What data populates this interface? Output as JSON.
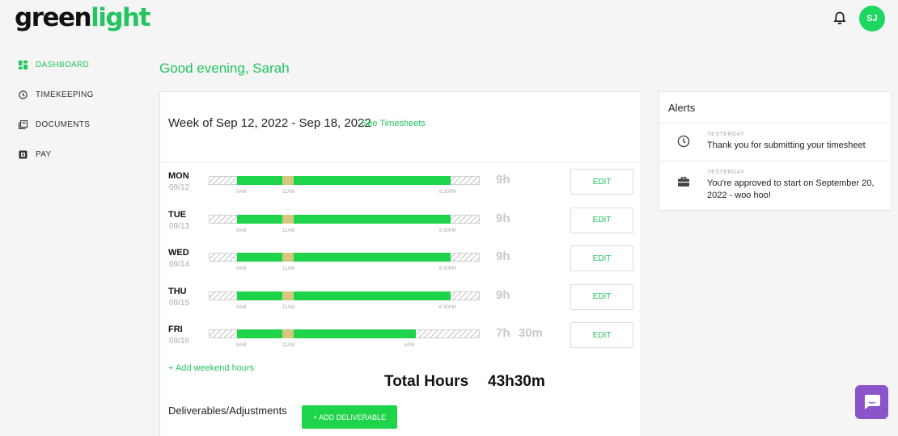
{
  "logo": {
    "part1": "green",
    "part2": "light"
  },
  "header": {
    "avatar_initials": "SJ"
  },
  "sidebar": {
    "items": [
      {
        "label": "DASHBOARD",
        "icon": "dashboard-icon"
      },
      {
        "label": "TIMEKEEPING",
        "icon": "clock-icon"
      },
      {
        "label": "DOCUMENTS",
        "icon": "documents-icon"
      },
      {
        "label": "PAY",
        "icon": "pay-icon"
      }
    ]
  },
  "greeting": "Good evening, Sarah",
  "timesheet": {
    "week_title": "Week of Sep 12, 2022 - Sep 18, 2022",
    "see_timesheets": "See Timesheets",
    "edit_label": "EDIT",
    "days": [
      {
        "day": "MON",
        "date": "09/12",
        "start": "9AM",
        "break": "11AM",
        "end": "6:30PM",
        "hours": "9h",
        "minutes": ""
      },
      {
        "day": "TUE",
        "date": "09/13",
        "start": "9AM",
        "break": "11AM",
        "end": "6:30PM",
        "hours": "9h",
        "minutes": ""
      },
      {
        "day": "WED",
        "date": "09/14",
        "start": "9AM",
        "break": "11AM",
        "end": "6:30PM",
        "hours": "9h",
        "minutes": ""
      },
      {
        "day": "THU",
        "date": "09/15",
        "start": "9AM",
        "break": "11AM",
        "end": "6:30PM",
        "hours": "9h",
        "minutes": ""
      },
      {
        "day": "FRI",
        "date": "09/16",
        "start": "9AM",
        "break": "11AM",
        "end": "5PM",
        "hours": "7h",
        "minutes": "30m"
      }
    ],
    "add_weekend": "+ Add weekend hours",
    "total_label": "Total Hours",
    "total_value": "43h30m",
    "deliverables_label": "Deliverables/Adjustments",
    "add_deliverable": "+ ADD DELIVERABLE"
  },
  "alerts": {
    "title": "Alerts",
    "items": [
      {
        "when": "YESTERDAY",
        "message": "Thank you for submitting your timesheet",
        "icon": "clock-icon"
      },
      {
        "when": "YESTERDAY",
        "message": "You're approved to start on September 20, 2022 - woo hoo!",
        "icon": "briefcase-icon"
      }
    ]
  },
  "colors": {
    "accent": "#22c55e",
    "work_bar": "#1ed44a",
    "break_bar": "#d3c87d",
    "chat": "#8a55c9"
  }
}
